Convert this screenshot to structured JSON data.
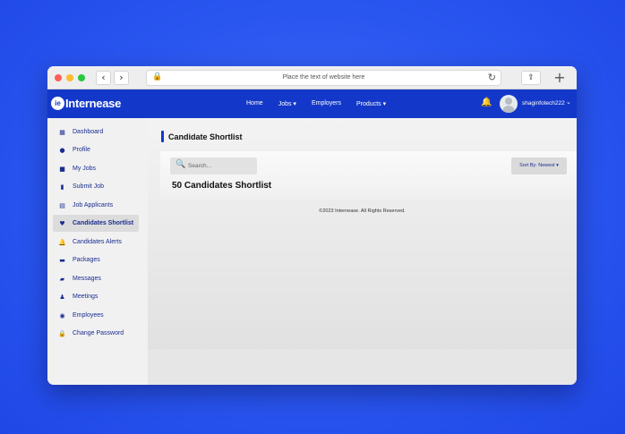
{
  "browser": {
    "url_placeholder": "Place the text of website here",
    "back_glyph": "‹",
    "forward_glyph": "›",
    "reload_glyph": "↻",
    "share_glyph": "⇪",
    "new_tab_glyph": "+",
    "lock_glyph": "🔒"
  },
  "header": {
    "logo_mark": "ie",
    "logo_text": "Internease",
    "nav": [
      {
        "label": "Home"
      },
      {
        "label": "Jobs ▾"
      },
      {
        "label": "Employers"
      },
      {
        "label": "Products ▾"
      }
    ],
    "bell_glyph": "🔔",
    "username": "shaginfotech222",
    "user_chevron": "⌄"
  },
  "sidebar": {
    "items": [
      {
        "label": "Dashboard",
        "icon": "dashboard-icon",
        "glyph": "▦"
      },
      {
        "label": "Profile",
        "icon": "profile-icon",
        "glyph": "●"
      },
      {
        "label": "My Jobs",
        "icon": "briefcase-icon",
        "glyph": "■"
      },
      {
        "label": "Submit Job",
        "icon": "document-icon",
        "glyph": "▮"
      },
      {
        "label": "Job Applicants",
        "icon": "clipboard-icon",
        "glyph": "▤"
      },
      {
        "label": "Candidates Shortlist",
        "icon": "heart-icon",
        "glyph": "♥"
      },
      {
        "label": "Candidates Alerts",
        "icon": "bell-icon",
        "glyph": "🔔"
      },
      {
        "label": "Packages",
        "icon": "package-icon",
        "glyph": "▬"
      },
      {
        "label": "Messages",
        "icon": "message-icon",
        "glyph": "▰"
      },
      {
        "label": "Meetings",
        "icon": "meetings-icon",
        "glyph": "♟"
      },
      {
        "label": "Employees",
        "icon": "employees-icon",
        "glyph": "◉"
      },
      {
        "label": "Change Password",
        "icon": "lock-icon",
        "glyph": "🔒"
      }
    ],
    "active_index": 5
  },
  "main": {
    "page_title": "Candidate Shortlist",
    "search_placeholder": "Search...",
    "search_glyph": "🔍",
    "sort_label": "Sort By: Newest  ▾",
    "count_title": "50 Candidates Shortlist",
    "footer": "©2023 Internease. All Rights Reserved."
  },
  "colors": {
    "brand": "#1338c9",
    "text_accent": "#1a2d8f",
    "page_background": "#2a56f0"
  }
}
